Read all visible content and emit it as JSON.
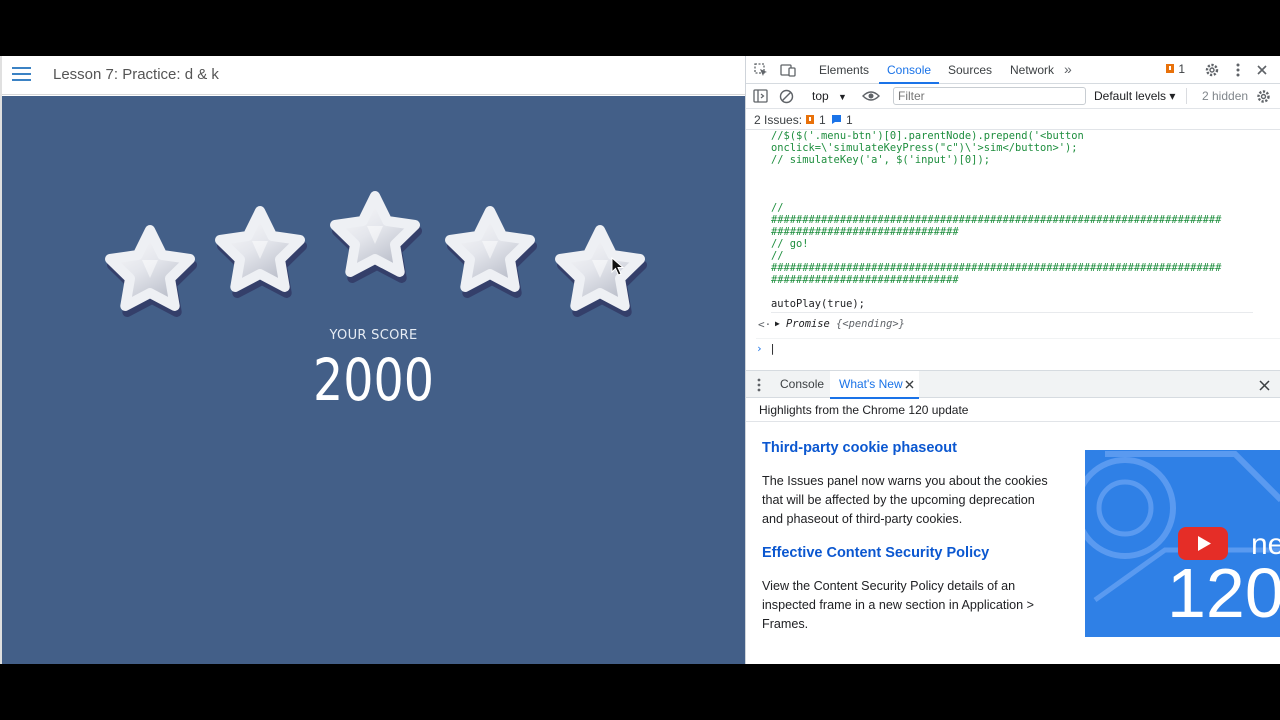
{
  "app": {
    "lesson_title": "Lesson 7: Practice: d & k",
    "score_label": "YOUR SCORE",
    "score_value": "2000",
    "stars_earned": 5,
    "stars_total": 5,
    "background_color": "#435f88"
  },
  "devtools": {
    "tabs": [
      "Elements",
      "Console",
      "Sources",
      "Network"
    ],
    "active_tab": "Console",
    "more_tabs_icon": "»",
    "issues_badge": "1",
    "context": "top",
    "filter_placeholder": "Filter",
    "levels": "Default levels ▾",
    "hidden": "2 hidden",
    "issues_label": "2 Issues:",
    "issues_warn_count": "1",
    "issues_info_count": "1",
    "code_lines": [
      "//$($('.menu-btn')[0].parentNode).prepend('<button",
      "onclick=\\'simulateKeyPress(\"c\")\\'>sim</button>');",
      "// simulateKey('a', $('input')[0]);",
      "//",
      "########################################################################",
      "##############################",
      "// go!",
      "//",
      "########################################################################",
      "##############################",
      "autoPlay(true);"
    ],
    "result_prefix": "Promise",
    "result_state": "{<pending>}",
    "drawer_tabs": [
      "Console",
      "What's New"
    ],
    "highlights": "Highlights from the Chrome 120 update",
    "whats_new": [
      {
        "title": "Third-party cookie phaseout",
        "body": "The Issues panel now warns you about the cookies that will be affected by the upcoming deprecation and phaseout of third-party cookies."
      },
      {
        "title": "Effective Content Security Policy",
        "body": "View the Content Security Policy details of an inspected frame in a new section in Application > Frames."
      }
    ],
    "promo_number": "120",
    "promo_text": "ne",
    "accent_color": "#1a73e8"
  }
}
